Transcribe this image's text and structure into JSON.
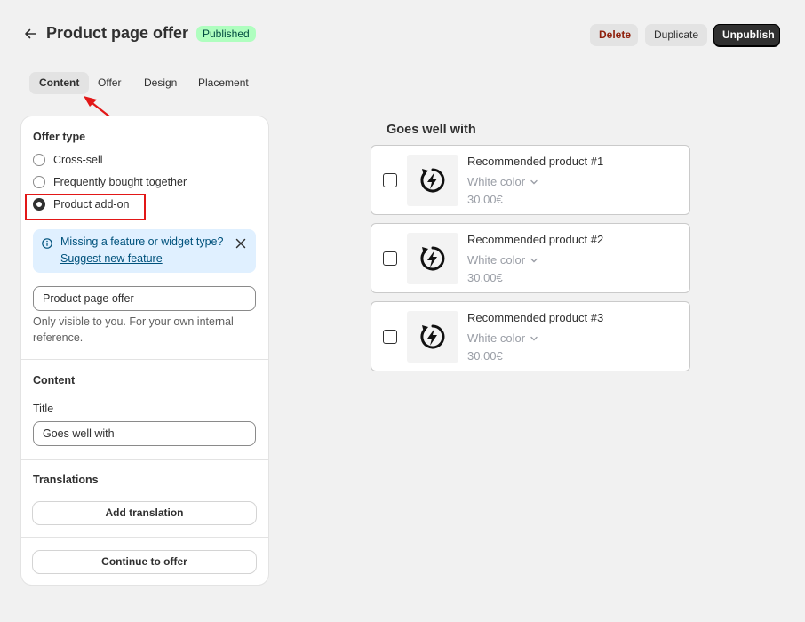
{
  "header": {
    "title": "Product page offer",
    "status_badge": "Published",
    "delete_label": "Delete",
    "duplicate_label": "Duplicate",
    "unpublish_label": "Unpublish"
  },
  "tabs": [
    {
      "label": "Content",
      "active": true
    },
    {
      "label": "Offer",
      "active": false
    },
    {
      "label": "Design",
      "active": false
    },
    {
      "label": "Placement",
      "active": false
    }
  ],
  "offer_type": {
    "heading": "Offer type",
    "options": [
      {
        "label": "Cross-sell",
        "selected": false
      },
      {
        "label": "Frequently bought together",
        "selected": false
      },
      {
        "label": "Product add-on",
        "selected": true
      }
    ]
  },
  "banner": {
    "message": "Missing a feature or widget type?",
    "link": "Suggest new feature"
  },
  "internal_name": {
    "value": "Product page offer",
    "help": "Only visible to you. For your own internal reference."
  },
  "content": {
    "heading": "Content",
    "title_label": "Title",
    "title_value": "Goes well with"
  },
  "translations": {
    "heading": "Translations",
    "add_label": "Add translation"
  },
  "continue_label": "Continue to offer",
  "preview": {
    "title": "Goes well with",
    "products": [
      {
        "name": "Recommended product #1",
        "variant": "White color",
        "price": "30.00€"
      },
      {
        "name": "Recommended product #2",
        "variant": "White color",
        "price": "30.00€"
      },
      {
        "name": "Recommended product #3",
        "variant": "White color",
        "price": "30.00€"
      }
    ]
  },
  "colors": {
    "annotation": "#e21717",
    "badge_bg": "#affebf",
    "banner_bg": "#e0f0ff",
    "primary_button": "#303030"
  }
}
